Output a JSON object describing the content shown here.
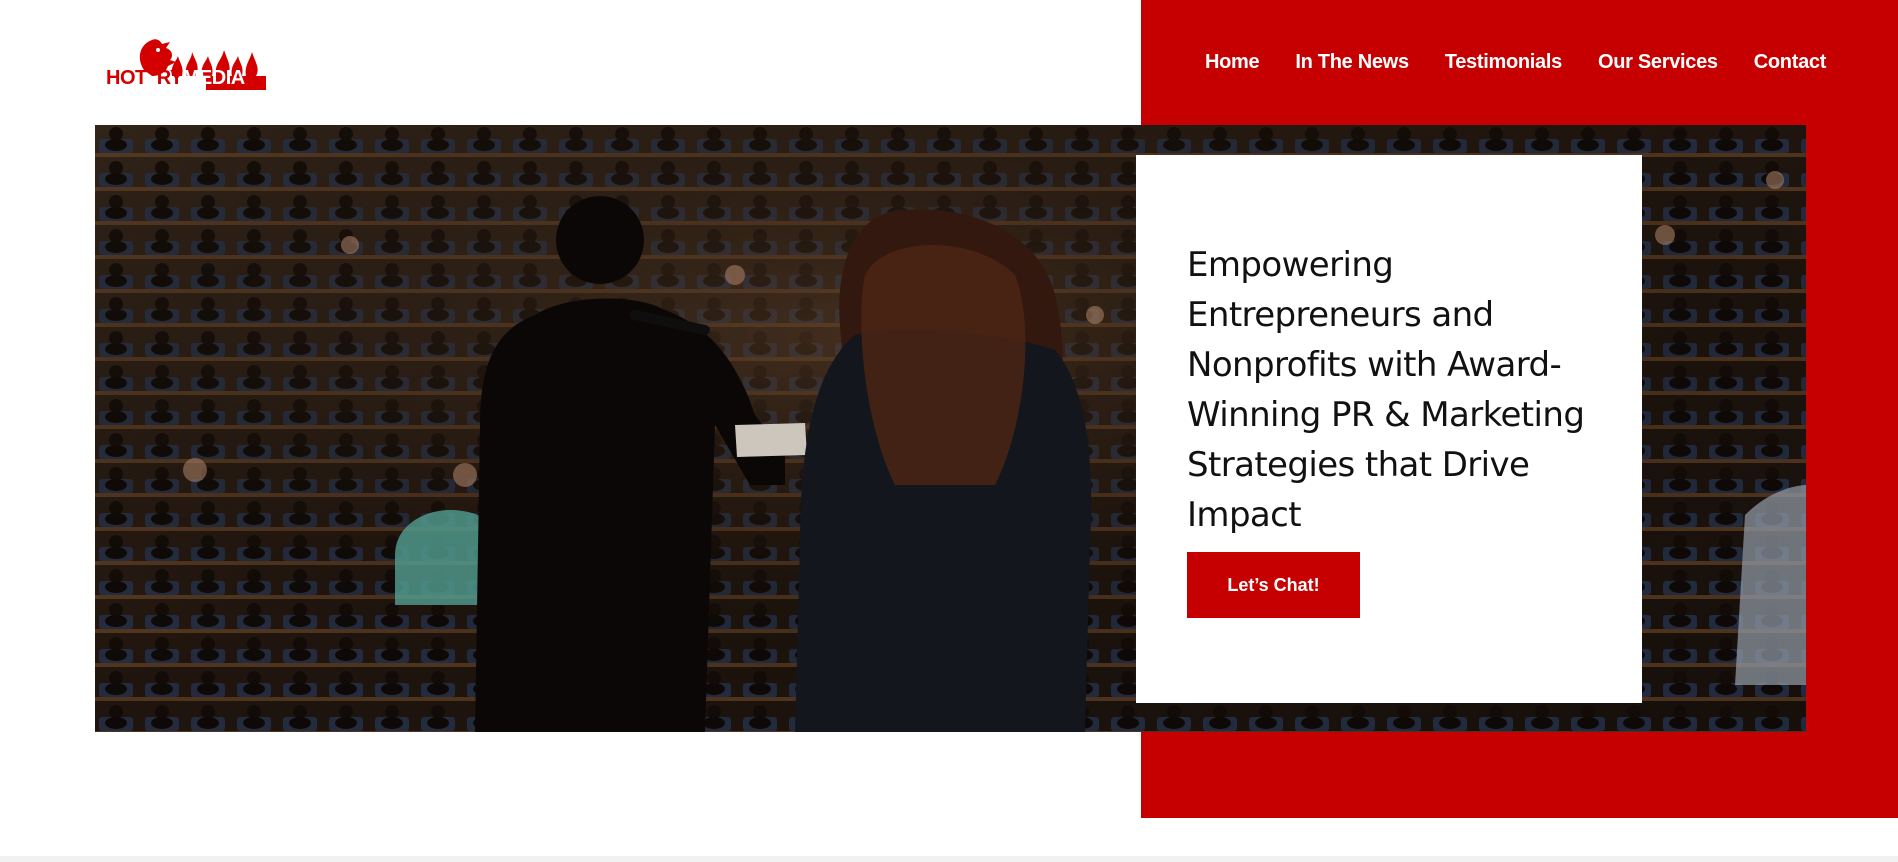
{
  "brand": {
    "logo_text_left": "HOT",
    "logo_text_mid": "RY",
    "logo_text_right": "MEDIA"
  },
  "nav": {
    "items": [
      {
        "label": "Home"
      },
      {
        "label": "In The News"
      },
      {
        "label": "Testimonials"
      },
      {
        "label": "Our Services"
      },
      {
        "label": "Contact"
      }
    ]
  },
  "hero": {
    "headline": "Empowering Entrepreneurs and Nonprofits with Award-Winning PR & Marketing Strategies that Drive Impact",
    "cta_label": "Let’s Chat!"
  },
  "colors": {
    "accent_red": "#c60000",
    "card_bg": "#ffffff",
    "text_dark": "#111111"
  }
}
